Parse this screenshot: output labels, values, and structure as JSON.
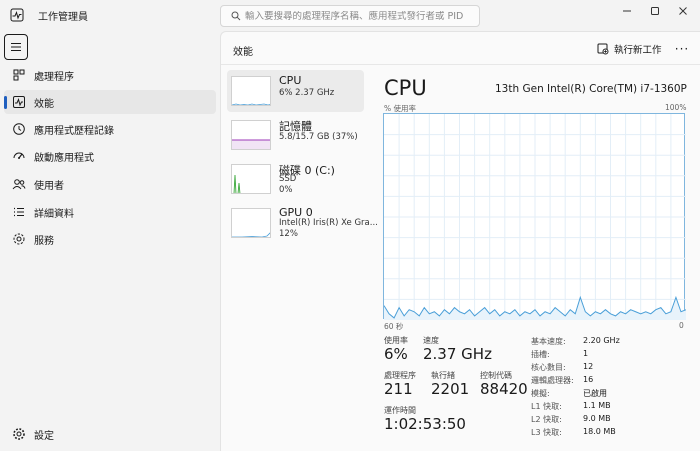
{
  "window": {
    "title": "工作管理員",
    "search_placeholder": "輸入要搜尋的處理程序名稱、應用程式發行者或 PID"
  },
  "nav": {
    "items": [
      {
        "label": "處理程序",
        "icon": "grid-icon"
      },
      {
        "label": "效能",
        "icon": "performance-icon",
        "active": true
      },
      {
        "label": "應用程式歷程記錄",
        "icon": "history-icon"
      },
      {
        "label": "啟動應用程式",
        "icon": "startup-icon"
      },
      {
        "label": "使用者",
        "icon": "users-icon"
      },
      {
        "label": "詳細資料",
        "icon": "list-icon"
      },
      {
        "label": "服務",
        "icon": "services-icon"
      }
    ],
    "settings_label": "設定"
  },
  "header": {
    "title": "效能",
    "run_task_label": "執行新工作",
    "more_label": "···"
  },
  "devices": [
    {
      "name": "CPU",
      "sub1": "6%  2.37 GHz",
      "sub2": ""
    },
    {
      "name": "記憶體",
      "sub1": "5.8/15.7 GB (37%)",
      "sub2": ""
    },
    {
      "name": "磁碟 0 (C:)",
      "sub1": "SSD",
      "sub2": "0%"
    },
    {
      "name": "GPU 0",
      "sub1": "Intel(R) Iris(R) Xe Gra...",
      "sub2": "12%"
    }
  ],
  "detail": {
    "title": "CPU",
    "model": "13th Gen Intel(R) Core(TM) i7-1360P",
    "y_label": "% 使用率",
    "y_max": "100%",
    "x_left": "60 秒",
    "x_right": "0",
    "stats": {
      "utilization_label": "使用率",
      "utilization": "6%",
      "speed_label": "速度",
      "speed": "2.37 GHz",
      "processes_label": "處理程序",
      "processes": "211",
      "threads_label": "執行緒",
      "threads": "2201",
      "handles_label": "控制代碼",
      "handles": "88420",
      "uptime_label": "運作時間",
      "uptime": "1:02:53:50"
    },
    "specs": [
      {
        "key": "基本速度:",
        "value": "2.20 GHz"
      },
      {
        "key": "插槽:",
        "value": "1"
      },
      {
        "key": "核心數目:",
        "value": "12"
      },
      {
        "key": "邏輯處理器:",
        "value": "16"
      },
      {
        "key": "模擬:",
        "value": "已啟用"
      },
      {
        "key": "L1 快取:",
        "value": "1.1 MB"
      },
      {
        "key": "L2 快取:",
        "value": "9.0 MB"
      },
      {
        "key": "L3 快取:",
        "value": "18.0 MB"
      }
    ]
  },
  "cpu_history": [
    7,
    3,
    1,
    6,
    2,
    5,
    4,
    2,
    6,
    3,
    4,
    2,
    5,
    3,
    6,
    4,
    3,
    5,
    2,
    4,
    6,
    3,
    5,
    2,
    4,
    3,
    5,
    2,
    4,
    3,
    5,
    2,
    4,
    3,
    6,
    4,
    2,
    5,
    3,
    11,
    4,
    2,
    4,
    3,
    5,
    3,
    2,
    4,
    3,
    5,
    4,
    3,
    4,
    3,
    5,
    6,
    3,
    4,
    11,
    4,
    5
  ],
  "colors": {
    "accent": "#1f5fbf",
    "cpu_line": "#4a9fd8",
    "mem_line": "#9c3ab8",
    "disk_line": "#3ba83b"
  }
}
